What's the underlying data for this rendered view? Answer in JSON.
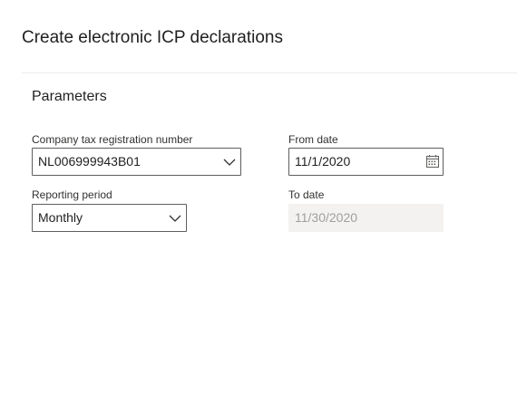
{
  "dialog": {
    "title": "Create electronic ICP declarations"
  },
  "parameters": {
    "section_title": "Parameters",
    "company_tax_registration": {
      "label": "Company tax registration number",
      "value": "NL006999943B01"
    },
    "reporting_period": {
      "label": "Reporting period",
      "value": "Monthly"
    },
    "from_date": {
      "label": "From date",
      "value": "11/1/2020"
    },
    "to_date": {
      "label": "To date",
      "value": "11/30/2020"
    }
  },
  "icons": {
    "dropdown": "chevron-down-icon",
    "date_picker": "calendar-icon"
  },
  "colors": {
    "border": "#605e5c",
    "disabled_background": "#f3f2f1",
    "disabled_text": "#a19f9d",
    "divider": "#edebe9"
  }
}
